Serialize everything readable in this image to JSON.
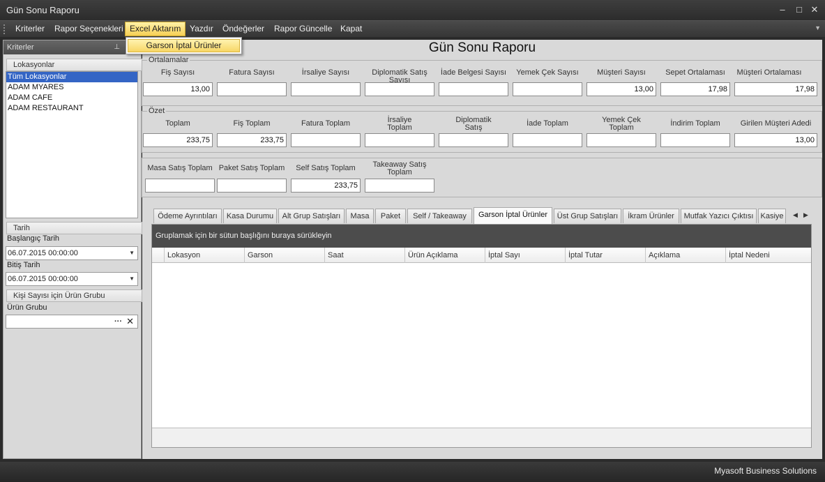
{
  "window": {
    "title": "Gün Sonu Raporu"
  },
  "menu": {
    "items": [
      "Kriterler",
      "Rapor Seçenekleri",
      "Excel Aktarım",
      "Yazdır",
      "Öndeğerler",
      "Rapor Güncelle",
      "Kapat"
    ],
    "active": "Excel Aktarım",
    "dropdown_item": "Garson İptal Ürünler"
  },
  "left_panel": {
    "title": "Kriterler",
    "locations_header": "Lokasyonlar",
    "locations": [
      "Tüm Lokasyonlar",
      "ADAM MYARES",
      "ADAM CAFE",
      "ADAM RESTAURANT"
    ],
    "selected_location": "Tüm Lokasyonlar",
    "date_header": "Tarih",
    "start_label": "Başlangıç Tarih",
    "start_value": "06.07.2015 00:00:00",
    "end_label": "Bitiş Tarih",
    "end_value": "06.07.2015 00:00:00",
    "product_group_header": "Kişi Sayısı için Ürün Grubu",
    "product_group_label": "Ürün Grubu",
    "product_group_value": ""
  },
  "report": {
    "title": "Gün Sonu Raporu",
    "averages": {
      "legend": "Ortalamalar",
      "fields": [
        {
          "label": "Fiş Sayısı",
          "value": "13,00"
        },
        {
          "label": "Fatura Sayısı",
          "value": ""
        },
        {
          "label": "İrsaliye Sayısı",
          "value": ""
        },
        {
          "label": "Diplomatik Satış Sayısı",
          "value": ""
        },
        {
          "label": "İade Belgesi Sayısı",
          "value": ""
        },
        {
          "label": "Yemek Çek Sayısı",
          "value": ""
        },
        {
          "label": "Müşteri Sayısı",
          "value": "13,00"
        },
        {
          "label": "Sepet Ortalaması",
          "value": "17,98"
        },
        {
          "label": "Müşteri Ortalaması",
          "value": "17,98"
        }
      ]
    },
    "summary": {
      "legend": "Özet",
      "fields": [
        {
          "label": "Toplam",
          "value": "233,75"
        },
        {
          "label": "Fiş Toplam",
          "value": "233,75"
        },
        {
          "label": "Fatura Toplam",
          "value": ""
        },
        {
          "label": "İrsaliye Toplam",
          "value": ""
        },
        {
          "label": "Diplomatik Satış",
          "value": ""
        },
        {
          "label": "İade Toplam",
          "value": ""
        },
        {
          "label": "Yemek Çek Toplam",
          "value": ""
        },
        {
          "label": "İndirim Toplam",
          "value": ""
        },
        {
          "label": "Girilen Müşteri Adedi",
          "value": "13,00"
        }
      ]
    },
    "sales": {
      "fields": [
        {
          "label": "Masa Satış Toplam",
          "value": ""
        },
        {
          "label": "Paket Satış Toplam",
          "value": ""
        },
        {
          "label": "Self Satış Toplam",
          "value": "233,75"
        },
        {
          "label": "Takeaway Satış Toplam",
          "value": ""
        }
      ]
    }
  },
  "tabs": {
    "items": [
      "Ödeme Ayrıntıları",
      "Kasa Durumu",
      "Alt Grup Satışları",
      "Masa",
      "Paket",
      "Self / Takeaway",
      "Garson İptal Ürünler",
      "Üst Grup Satışları",
      "İkram Ürünler",
      "Mutfak Yazıcı Çıktısı",
      "Kasiye"
    ],
    "active": "Garson İptal Ürünler"
  },
  "grid": {
    "group_hint": "Gruplamak için bir sütun başlığını buraya sürükleyin",
    "columns": [
      "Lokasyon",
      "Garson",
      "Saat",
      "Ürün Açıklama",
      "İptal Sayı",
      "İptal Tutar",
      "Açıklama",
      "İptal Nedeni"
    ],
    "rows": []
  },
  "status": {
    "brand": "Myasoft Business Solutions"
  }
}
